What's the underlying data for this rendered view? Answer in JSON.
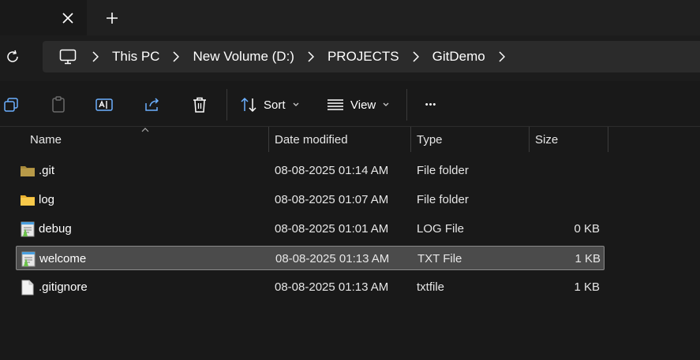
{
  "tabs": {
    "close_glyph": "✕",
    "new_glyph": "+"
  },
  "address": {
    "crumbs": [
      "This PC",
      "New Volume (D:)",
      "PROJECTS",
      "GitDemo"
    ]
  },
  "toolbar": {
    "sort_label": "Sort",
    "view_label": "View",
    "more_glyph": "•••"
  },
  "columns": {
    "name": "Name",
    "date": "Date modified",
    "type": "Type",
    "size": "Size"
  },
  "files": [
    {
      "name": ".git",
      "date": "08-08-2025 01:14 AM",
      "type": "File folder",
      "size": "",
      "icon": "folder-dark-icon"
    },
    {
      "name": "log",
      "date": "08-08-2025 01:07 AM",
      "type": "File folder",
      "size": "",
      "icon": "folder-icon"
    },
    {
      "name": "debug",
      "date": "08-08-2025 01:01 AM",
      "type": "LOG File",
      "size": "0 KB",
      "icon": "notepad-file-icon"
    },
    {
      "name": "welcome",
      "date": "08-08-2025 01:13 AM",
      "type": "TXT File",
      "size": "1 KB",
      "icon": "notepad-file-icon",
      "selected": true
    },
    {
      "name": ".gitignore",
      "date": "08-08-2025 01:13 AM",
      "type": "txtfile",
      "size": "1 KB",
      "icon": "blank-file-icon"
    }
  ],
  "colors": {
    "background": "#191919",
    "tabstrip": "#202020",
    "addressbar": "#2b2b2b",
    "selection": "#4b4b4b",
    "accent": "#6cb0ff",
    "folder": "#f8c94a"
  }
}
